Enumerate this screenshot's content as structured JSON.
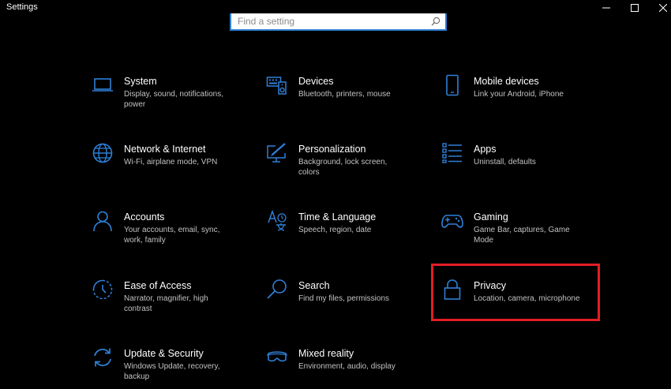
{
  "window": {
    "title": "Settings",
    "minimize_icon": "minimize-icon",
    "maximize_icon": "maximize-icon",
    "close_icon": "close-icon"
  },
  "search": {
    "placeholder": "Find a setting",
    "value": "",
    "icon": "search-icon"
  },
  "colors": {
    "background": "#000000",
    "accent": "#2f7fd6",
    "text": "#ffffff",
    "subtext": "#c2c2c2",
    "highlight": "#e41e25"
  },
  "tiles": [
    {
      "name": "System",
      "desc": "Display, sound, notifications, power",
      "icon": "laptop-icon"
    },
    {
      "name": "Devices",
      "desc": "Bluetooth, printers, mouse",
      "icon": "keyboard-speaker-icon"
    },
    {
      "name": "Mobile devices",
      "desc": "Link your Android, iPhone",
      "icon": "phone-icon"
    },
    {
      "name": "Network & Internet",
      "desc": "Wi-Fi, airplane mode, VPN",
      "icon": "globe-icon"
    },
    {
      "name": "Personalization",
      "desc": "Background, lock screen, colors",
      "icon": "pen-monitor-icon"
    },
    {
      "name": "Apps",
      "desc": "Uninstall, defaults",
      "icon": "apps-list-icon"
    },
    {
      "name": "Accounts",
      "desc": "Your accounts, email, sync, work, family",
      "icon": "person-icon"
    },
    {
      "name": "Time & Language",
      "desc": "Speech, region, date",
      "icon": "time-language-icon"
    },
    {
      "name": "Gaming",
      "desc": "Game Bar, captures, Game Mode",
      "icon": "gamepad-icon"
    },
    {
      "name": "Ease of Access",
      "desc": "Narrator, magnifier, high contrast",
      "icon": "ease-of-access-icon"
    },
    {
      "name": "Search",
      "desc": "Find my files, permissions",
      "icon": "magnifier-icon"
    },
    {
      "name": "Privacy",
      "desc": "Location, camera, microphone",
      "icon": "lock-icon"
    },
    {
      "name": "Update & Security",
      "desc": "Windows Update, recovery, backup",
      "icon": "sync-icon"
    },
    {
      "name": "Mixed reality",
      "desc": "Environment, audio, display",
      "icon": "vr-headset-icon"
    }
  ]
}
